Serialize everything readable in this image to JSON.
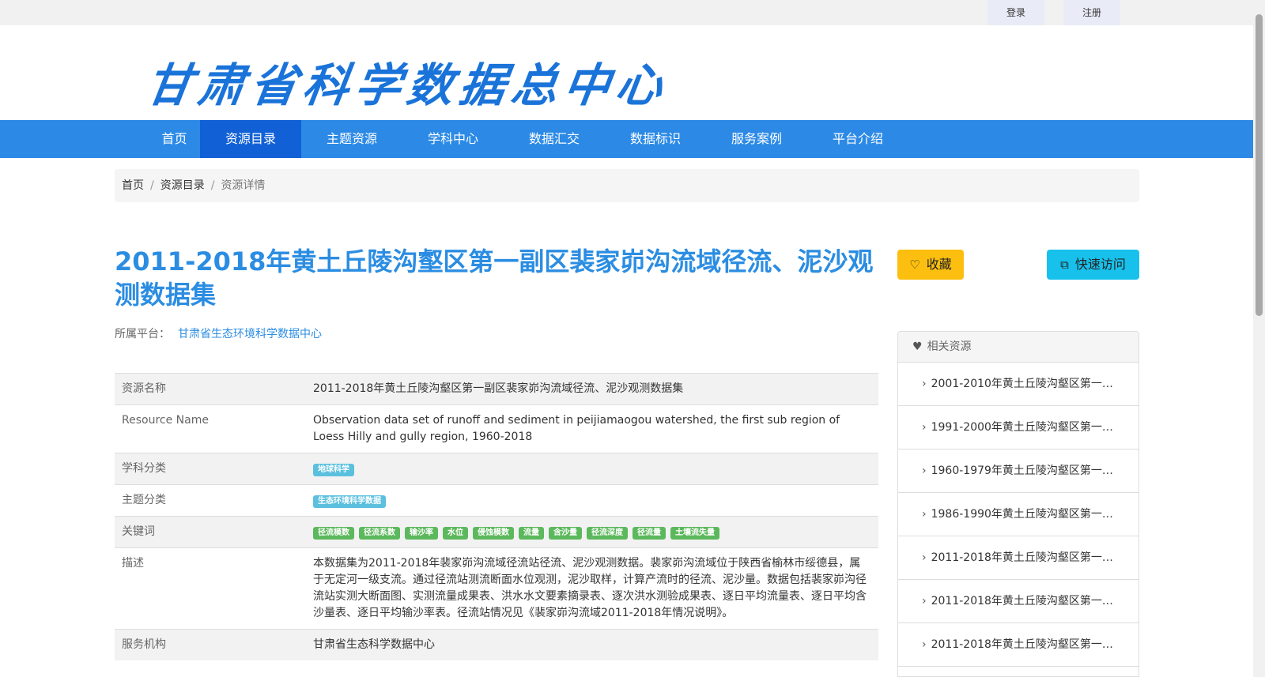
{
  "topbar": {
    "login": "登录",
    "register": "注册"
  },
  "header": {
    "logo": "甘肃省科学数据总中心"
  },
  "nav": {
    "items": [
      {
        "label": "首页"
      },
      {
        "label": "资源目录"
      },
      {
        "label": "主题资源"
      },
      {
        "label": "学科中心"
      },
      {
        "label": "数据汇交"
      },
      {
        "label": "数据标识"
      },
      {
        "label": "服务案例"
      },
      {
        "label": "平台介绍"
      }
    ],
    "active": "资源目录"
  },
  "breadcrumb": {
    "home": "首页",
    "catalog": "资源目录",
    "current": "资源详情",
    "separator": "/"
  },
  "dataset": {
    "title": "2011-2018年黄土丘陵沟壑区第一副区裴家峁沟流域径流、泥沙观测数据集",
    "platform_label": "所属平台：",
    "platform_name": "甘肃省生态环境科学数据中心"
  },
  "actions": {
    "favorite": "收藏",
    "quick_access": "快速访问"
  },
  "table": {
    "resource_name_label": "资源名称",
    "resource_name": "2011-2018年黄土丘陵沟壑区第一副区裴家峁沟流域径流、泥沙观测数据集",
    "resource_name_en_label": "Resource Name",
    "resource_name_en": "Observation data set of runoff and sediment in peijiamaogou watershed, the first sub region of Loess Hilly and gully region, 1960-2018",
    "subject_label": "学科分类",
    "subject": "地球科学",
    "theme_label": "主题分类",
    "theme": "生态环境科学数据",
    "keywords_label": "关键词",
    "keywords": [
      "径流模数",
      "径流系数",
      "输沙率",
      "水位",
      "侵蚀模数",
      "流量",
      "含沙量",
      "径流深度",
      "径流量",
      "土壤流失量"
    ],
    "description_label": "描述",
    "description": "本数据集为2011-2018年裴家峁沟流域径流站径流、泥沙观测数据。裴家峁沟流域位于陕西省榆林市绥德县，属于无定河一级支流。通过径流站测流断面水位观测，泥沙取样，计算产流时的径流、泥沙量。数据包括裴家峁沟径流站实测大断面图、实测流量成果表、洪水水文要素摘录表、逐次洪水测验成果表、逐日平均流量表、逐日平均含沙量表、逐日平均输沙率表。径流站情况见《裴家峁沟流域2011-2018年情况说明》。",
    "service_label": "服务机构",
    "service": "甘肃省生态科学数据中心"
  },
  "related": {
    "title": "相关资源",
    "items": [
      "2001-2010年黄土丘陵沟壑区第一…",
      "1991-2000年黄土丘陵沟壑区第一…",
      "1960-1979年黄土丘陵沟壑区第一…",
      "1986-1990年黄土丘陵沟壑区第一…",
      "2011-2018年黄土丘陵沟壑区第一…",
      "2011-2018年黄土丘陵沟壑区第一…",
      "2011-2018年黄土丘陵沟壑区第一…"
    ]
  },
  "icons": {
    "favorite": "heart-icon",
    "quick_access": "external-link-icon",
    "related": "heart-icon",
    "related_item": "chevron-right-icon"
  },
  "colors": {
    "nav": "#2c8ae6",
    "nav_active": "#1160d6",
    "title": "#2b8de2",
    "favorite": "#fdbf0f",
    "quick_access": "#17c1ec",
    "badge_info": "#5bc0de",
    "badge_success": "#5cb85c"
  }
}
